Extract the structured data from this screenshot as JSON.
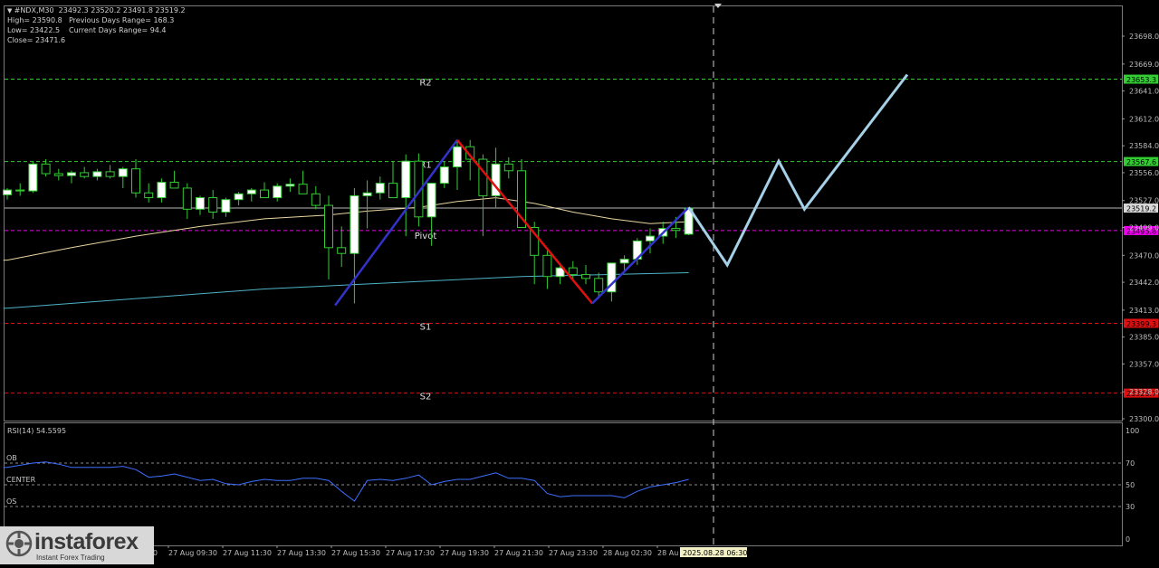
{
  "header": {
    "symbol_line": "#NDX,M30  23492.3 23520.2 23491.8 23519.2",
    "high": "High= 23590.8",
    "prev_range": "Previous Days Range= 168.3",
    "low": "Low= 23422.5",
    "curr_range": "Current Days Range= 94.4",
    "close": "Close= 23471.6"
  },
  "logo": {
    "name": "instaforex",
    "tagline": "Instant Forex Trading"
  },
  "colors": {
    "background": "#000000",
    "bull_candle": "#ffffff",
    "bear_candle": "#000000",
    "wick": "#33cc33",
    "up_leg": "#3333cc",
    "down_leg": "#e01010",
    "projection": "#a6cfe8",
    "ma_slow": "#4fb3c8",
    "ma_fast": "#e8d4a0",
    "rsi_line": "#3f6fff",
    "level_green": "#33cc33",
    "level_red": "#dd1111",
    "level_magenta": "#ee00ee"
  },
  "chart_data": [
    {
      "type": "candlestick",
      "symbol": "#NDX",
      "timeframe": "M30",
      "ylim": [
        23300,
        23730
      ],
      "y_ticks": [
        "23698.0",
        "23669.0",
        "23641.0",
        "23612.0",
        "23584.0",
        "23556.0",
        "23527.0",
        "23499.0",
        "23470.0",
        "23442.0",
        "23413.0",
        "23385.0",
        "23357.0",
        "23328.0",
        "23300.0"
      ],
      "x_ticks": [
        "27 Aug 09:30",
        "27 Aug 11:30",
        "27 Aug 13:30",
        "27 Aug 15:30",
        "27 Aug 17:30",
        "27 Aug 19:30",
        "27 Aug 21:30",
        "27 Aug 23:30",
        "28 Aug 02:30",
        "28 Au"
      ],
      "x_tick_first_partial": "30",
      "current_time_label": "2025.08.28 06:30",
      "candles": [
        [
          23533,
          23540,
          23528,
          23538
        ],
        [
          23538,
          23545,
          23532,
          23537
        ],
        [
          23537,
          23568,
          23535,
          23565
        ],
        [
          23565,
          23570,
          23552,
          23555
        ],
        [
          23555,
          23560,
          23548,
          23553
        ],
        [
          23553,
          23558,
          23545,
          23556
        ],
        [
          23556,
          23562,
          23550,
          23552
        ],
        [
          23552,
          23560,
          23548,
          23557
        ],
        [
          23557,
          23564,
          23550,
          23552
        ],
        [
          23552,
          23562,
          23540,
          23560
        ],
        [
          23560,
          23570,
          23530,
          23535
        ],
        [
          23535,
          23545,
          23525,
          23530
        ],
        [
          23530,
          23550,
          23525,
          23546
        ],
        [
          23546,
          23558,
          23540,
          23540
        ],
        [
          23540,
          23545,
          23508,
          23518
        ],
        [
          23518,
          23532,
          23512,
          23530
        ],
        [
          23530,
          23538,
          23508,
          23515
        ],
        [
          23515,
          23530,
          23510,
          23528
        ],
        [
          23528,
          23536,
          23522,
          23534
        ],
        [
          23534,
          23540,
          23526,
          23538
        ],
        [
          23538,
          23546,
          23530,
          23530
        ],
        [
          23530,
          23545,
          23526,
          23542
        ],
        [
          23542,
          23550,
          23536,
          23544
        ],
        [
          23544,
          23558,
          23538,
          23534
        ],
        [
          23534,
          23542,
          23518,
          23522
        ],
        [
          23522,
          23532,
          23445,
          23478
        ],
        [
          23478,
          23500,
          23458,
          23472
        ],
        [
          23472,
          23540,
          23420,
          23532
        ],
        [
          23532,
          23548,
          23498,
          23535
        ],
        [
          23535,
          23552,
          23528,
          23545
        ],
        [
          23545,
          23568,
          23540,
          23530
        ],
        [
          23530,
          23575,
          23490,
          23568
        ],
        [
          23568,
          23576,
          23500,
          23510
        ],
        [
          23510,
          23540,
          23480,
          23545
        ],
        [
          23545,
          23568,
          23540,
          23562
        ],
        [
          23562,
          23588,
          23538,
          23583
        ],
        [
          23583,
          23590,
          23548,
          23570
        ],
        [
          23570,
          23575,
          23490,
          23532
        ],
        [
          23532,
          23582,
          23520,
          23565
        ],
        [
          23565,
          23572,
          23550,
          23558
        ],
        [
          23558,
          23570,
          23530,
          23499
        ],
        [
          23499,
          23505,
          23440,
          23470
        ],
        [
          23470,
          23475,
          23435,
          23448
        ],
        [
          23448,
          23462,
          23440,
          23457
        ],
        [
          23457,
          23464,
          23445,
          23450
        ],
        [
          23450,
          23460,
          23440,
          23446
        ],
        [
          23446,
          23452,
          23425,
          23432
        ],
        [
          23432,
          23460,
          23422,
          23462
        ],
        [
          23462,
          23470,
          23452,
          23466
        ],
        [
          23466,
          23488,
          23460,
          23485
        ],
        [
          23485,
          23498,
          23472,
          23490
        ],
        [
          23490,
          23505,
          23482,
          23498
        ],
        [
          23498,
          23510,
          23488,
          23496
        ],
        [
          23492,
          23520,
          23491,
          23519
        ]
      ],
      "ma_fast": [
        [
          0,
          23465
        ],
        [
          5,
          23478
        ],
        [
          10,
          23490
        ],
        [
          15,
          23500
        ],
        [
          20,
          23508
        ],
        [
          25,
          23512
        ],
        [
          28,
          23516
        ],
        [
          32,
          23520
        ],
        [
          35,
          23526
        ],
        [
          38,
          23530
        ],
        [
          41,
          23524
        ],
        [
          44,
          23515
        ],
        [
          47,
          23508
        ],
        [
          50,
          23503
        ],
        [
          53,
          23505
        ]
      ],
      "ma_slow": [
        [
          0,
          23415
        ],
        [
          20,
          23435
        ],
        [
          40,
          23448
        ],
        [
          53,
          23452
        ]
      ],
      "levels": [
        {
          "label": "R2",
          "value": 23653.3,
          "tag": "23653.3",
          "color": "#33cc33"
        },
        {
          "label": "R1",
          "value": 23567.6,
          "tag": "23567.6",
          "color": "#33cc33"
        },
        {
          "label": "Pivot",
          "value": 23495.8,
          "tag": "23495.8",
          "color": "#ee00ee"
        },
        {
          "label": "S1",
          "value": 23399.3,
          "tag": "23399.3",
          "color": "#dd1111"
        },
        {
          "label": "S2",
          "value": 23326.7,
          "tag": "23326.7",
          "color": "#dd1111"
        }
      ],
      "current_price": {
        "value": 23519.2,
        "tag": "23519.2"
      },
      "pattern": {
        "up_leg_1": [
          [
            25.5,
            23418
          ],
          [
            35,
            23590
          ]
        ],
        "down_leg": [
          [
            35,
            23590
          ],
          [
            45.5,
            23420
          ]
        ],
        "up_leg_2": [
          [
            45.5,
            23420
          ],
          [
            53,
            23520
          ]
        ]
      },
      "projection": [
        [
          53,
          23520
        ],
        [
          56,
          23460
        ],
        [
          60,
          23568
        ],
        [
          62,
          23518
        ],
        [
          70,
          23658
        ]
      ],
      "projection_x_extent": 70
    },
    {
      "type": "line",
      "indicator": "RSI(14)",
      "value_label": "RSI(14) 54.5595",
      "ylim": [
        0,
        100
      ],
      "y_ticks": [
        "100",
        "70",
        "50",
        "30",
        "0"
      ],
      "levels": [
        {
          "label": "OB",
          "value": 70
        },
        {
          "label": "CENTER",
          "value": 50
        },
        {
          "label": "OS",
          "value": 30
        }
      ],
      "series": [
        {
          "values": [
            66,
            68,
            70,
            71,
            69,
            66,
            66,
            66,
            66,
            67,
            64,
            57,
            58,
            60,
            57,
            54,
            55,
            51,
            50,
            53,
            55,
            54,
            54,
            56,
            56,
            54,
            44,
            35,
            54,
            55,
            54,
            56,
            59,
            50,
            53,
            55,
            55,
            58,
            61,
            56,
            56,
            54,
            42,
            39,
            40,
            40,
            40,
            40,
            38,
            44,
            48,
            50,
            52,
            55
          ]
        }
      ]
    }
  ]
}
